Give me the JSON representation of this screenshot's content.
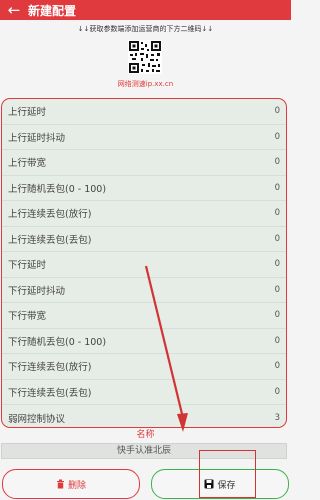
{
  "appbar": {
    "title": "新建配置",
    "back_icon": "arrow-left-icon"
  },
  "hint": "↓↓获取参数端添加运营商的下方二维码↓↓",
  "link": "网络测速ip.xx.cn",
  "rows": [
    {
      "label": "上行延时",
      "value": "0"
    },
    {
      "label": "上行延时抖动",
      "value": "0"
    },
    {
      "label": "上行带宽",
      "value": "0"
    },
    {
      "label": "上行随机丢包(0 - 100)",
      "value": "0"
    },
    {
      "label": "上行连续丢包(放行)",
      "value": "0"
    },
    {
      "label": "上行连续丢包(丢包)",
      "value": "0"
    },
    {
      "label": "下行延时",
      "value": "0"
    },
    {
      "label": "下行延时抖动",
      "value": "0"
    },
    {
      "label": "下行带宽",
      "value": "0"
    },
    {
      "label": "下行随机丢包(0 - 100)",
      "value": "0"
    },
    {
      "label": "下行连续丢包(放行)",
      "value": "0"
    },
    {
      "label": "下行连续丢包(丢包)",
      "value": "0"
    },
    {
      "label": "弱网控制协议",
      "value": "3"
    }
  ],
  "name_label": "名称",
  "name_value": "快手认准北辰",
  "buttons": {
    "delete": "删除",
    "save": "保存"
  },
  "colors": {
    "accent": "#e0393e",
    "save_border": "#3cb04a"
  }
}
